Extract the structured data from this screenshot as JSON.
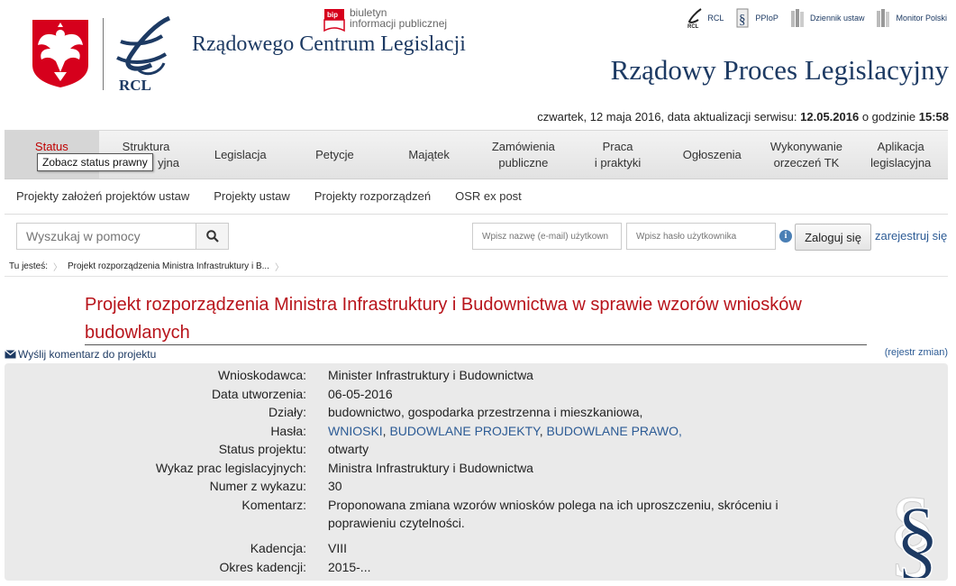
{
  "header": {
    "bip_text_1": "biuletyn",
    "bip_text_2": "informacji publicznej",
    "rcl_logo_text": "RCL",
    "rcl_title": "Rządowego Centrum Legislacji",
    "site_title": "Rządowy Proces Legislacyjny",
    "toplinks": [
      "RCL",
      "PPIoP",
      "Dziennik ustaw",
      "Monitor Polski"
    ]
  },
  "date_line": {
    "prefix": "czwartek, 12 maja 2016, data aktualizacji serwisu:",
    "update_date": "12.05.2016",
    "middle": "o godzinie",
    "time": "15:58"
  },
  "mainnav": {
    "items": [
      {
        "line1": "Status",
        "line2": "pra"
      },
      {
        "line1": "Struktura",
        "line2": "yjna"
      },
      {
        "line1": "Legislacja",
        "line2": ""
      },
      {
        "line1": "Petycje",
        "line2": ""
      },
      {
        "line1": "Majątek",
        "line2": ""
      },
      {
        "line1": "Zamówienia",
        "line2": "publiczne"
      },
      {
        "line1": "Praca",
        "line2": "i praktyki"
      },
      {
        "line1": "Ogłoszenia",
        "line2": ""
      },
      {
        "line1": "Wykonywanie",
        "line2": "orzeczeń TK"
      },
      {
        "line1": "Aplikacja",
        "line2": "legislacyjna"
      }
    ],
    "tooltip": "Zobacz status prawny"
  },
  "subnav": [
    "Projekty założeń projektów ustaw",
    "Projekty ustaw",
    "Projekty rozporządzeń",
    "OSR ex post"
  ],
  "search": {
    "placeholder": "Wyszukaj w pomocy"
  },
  "login": {
    "email_placeholder": "Wpisz nazwę (e-mail) użytkown",
    "password_placeholder": "Wpisz hasło użytkownika",
    "button": "Zaloguj się",
    "register": "zarejestruj się"
  },
  "breadcrumb": {
    "label": "Tu jesteś:",
    "current": "Projekt rozporządzenia Ministra Infrastruktury i B..."
  },
  "project": {
    "title": "Projekt rozporządzenia Ministra Infrastruktury i Budownictwa w sprawie wzorów wniosków budowlanych",
    "send_comment": "Wyślij komentarz do projektu",
    "registry": "(rejestr zmian)",
    "fields": {
      "applicant_label": "Wnioskodawca:",
      "applicant": "Minister Infrastruktury i Budownictwa",
      "created_label": "Data utworzenia:",
      "created": "06-05-2016",
      "departments_label": "Działy:",
      "departments": "budownictwo, gospodarka przestrzenna i mieszkaniowa,",
      "keywords_label": "Hasła:",
      "keyword_1": "WNIOSKI",
      "keyword_2": "BUDOWLANE PROJEKTY",
      "keyword_3": "BUDOWLANE PRAWO",
      "status_label": "Status projektu:",
      "status": "otwarty",
      "list_label": "Wykaz prac legislacyjnych:",
      "list": "Ministra Infrastruktury i Budownictwa",
      "number_label": "Numer z wykazu:",
      "number": "30",
      "comment_label": "Komentarz:",
      "comment": "Proponowana zmiana wzorów wniosków polega na ich uproszczeniu, skróceniu i poprawieniu czytelności.",
      "term_label": "Kadencja:",
      "term": "VIII",
      "term_period_label": "Okres kadencji:",
      "term_period": "2015-..."
    }
  }
}
